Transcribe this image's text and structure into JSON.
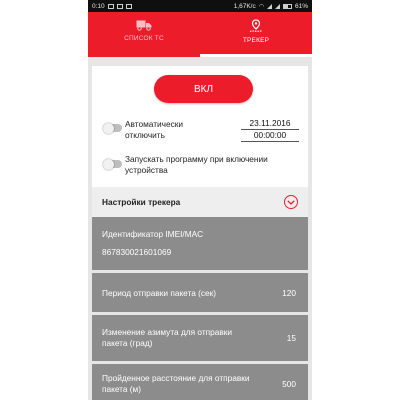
{
  "status_bar": {
    "time": "0:10",
    "speed": "1,67K/c",
    "battery": "61%"
  },
  "tabs": [
    {
      "label": "СПИСОК ТС",
      "icon": "truck-icon",
      "active": false
    },
    {
      "label": "ТРЕКЕР",
      "icon": "route-pin-icon",
      "active": true
    }
  ],
  "main": {
    "on_button_label": "ВКЛ",
    "auto_off_label": "Автоматически отключить",
    "auto_off_date": "23.11.2016",
    "auto_off_time": "00:00:00",
    "startup_label": "Запускать программу при включении устройства"
  },
  "settings": {
    "title": "Настройки трекера",
    "rows": [
      {
        "label": "Идентификатор IMEI/MAC",
        "value": "867830021601069"
      },
      {
        "label": "Период отправки пакета (сек)",
        "value": "120"
      },
      {
        "label": "Изменение азимута для отправки пакета (град)",
        "value": "15"
      },
      {
        "label": "Пройденное расстояние для отправки пакета (м)",
        "value": "500"
      }
    ]
  },
  "colors": {
    "accent": "#ec1c2b",
    "row_bg": "#8c8c8c",
    "toggle_off": "#bdbdbd"
  }
}
